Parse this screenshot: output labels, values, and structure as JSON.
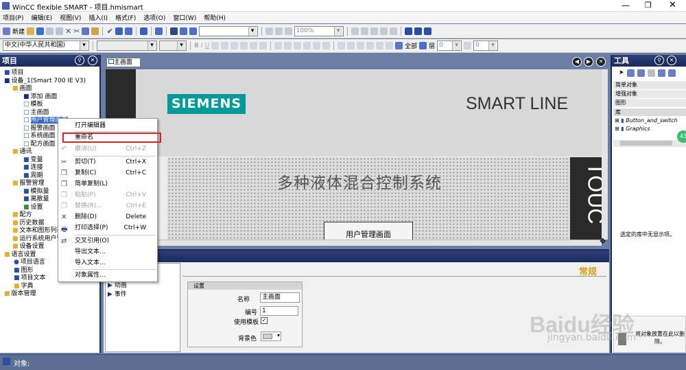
{
  "window": {
    "title": "WinCC flexible SMART - 项目.hmismart"
  },
  "menu": [
    "项目(P)",
    "编辑(E)",
    "视图(V)",
    "插入(I)",
    "格式(F)",
    "选项(O)",
    "窗口(W)",
    "帮助(H)"
  ],
  "toolbar": {
    "new_label": "新建",
    "zoom": "100%",
    "language": "中文(中华人民共和国)",
    "all_label": "全部",
    "layer": "层",
    "layer_value": "0",
    "other_value": "0"
  },
  "project_panel": {
    "title": "项目",
    "items": [
      "项目",
      "设备_1(Smart 700 IE V3)",
      "画面",
      "添加 画面",
      "模板",
      "主画面",
      "用户管理画面",
      "报警画面",
      "系统画面",
      "配方画面",
      "通讯",
      "变量",
      "连接",
      "周期",
      "报警管理",
      "模拟量",
      "离散量",
      "设置",
      "配方",
      "历史数据",
      "文本和图形列表",
      "运行系统用户管理",
      "设备设置",
      "语言设置",
      "项目语言",
      "图形",
      "项目文本",
      "字典",
      "版本管理"
    ]
  },
  "editor": {
    "tab": "主画面",
    "brand": "SIEMENS",
    "product": "SMART LINE",
    "screen_title": "多种液体混合控制系统",
    "button_text": "用户管理画面",
    "side_text": "TOUC"
  },
  "context_menu": {
    "items": [
      {
        "label": "打开编辑器"
      },
      {
        "label": "重命名"
      },
      {
        "label": "撤消(U)",
        "shortcut": "Ctrl+Z"
      },
      {
        "label": "剪切(T)",
        "shortcut": "Ctrl+X"
      },
      {
        "label": "复制(C)",
        "shortcut": "Ctrl+C"
      },
      {
        "label": "简单复制(L)"
      },
      {
        "label": "粘贴(P)",
        "shortcut": "Ctrl+V"
      },
      {
        "label": "替换(R)...",
        "shortcut": "Ctrl+E"
      },
      {
        "label": "删除(D)",
        "shortcut": "Delete"
      },
      {
        "label": "打印选择(P)",
        "shortcut": "Ctrl+W"
      },
      {
        "label": "交叉引用(O)"
      },
      {
        "label": "导出文本..."
      },
      {
        "label": "导入文本..."
      },
      {
        "label": "对象属性..."
      }
    ]
  },
  "properties": {
    "section": "常规",
    "left_items": [
      "动画",
      "事件"
    ],
    "group": "设置",
    "name_label": "名称",
    "name_value": "主画面",
    "number_label": "编号",
    "number_value": "1",
    "template_label": "使用模板",
    "bg_label": "背景色"
  },
  "tools_panel": {
    "title": "工具",
    "sections": [
      "简单对象",
      "增强对象",
      "图形",
      "库"
    ],
    "library_items": [
      "Button_and_switch",
      "Graphics"
    ],
    "empty_msg": "选定的库中无显示项。",
    "delete_hint": "将对象放置在此以删除。",
    "badge": "43"
  },
  "status": {
    "object_label": "对象:"
  },
  "watermark": {
    "logo": "Baidu经验",
    "url": "jingyan.baidu.com"
  }
}
